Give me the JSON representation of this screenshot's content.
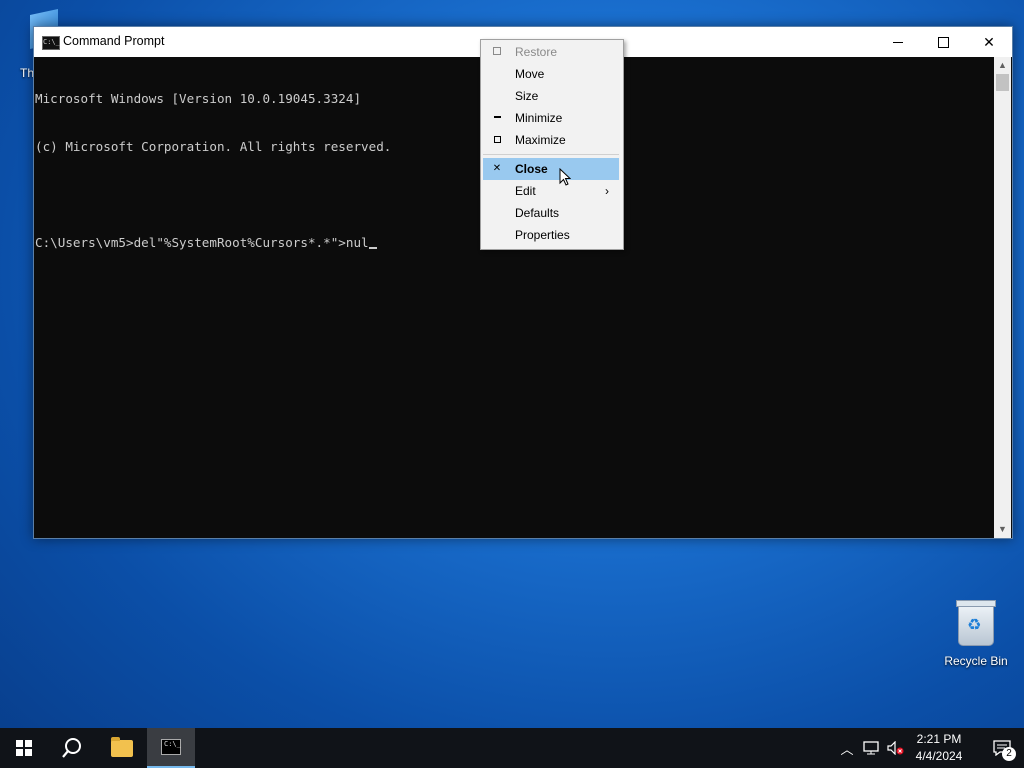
{
  "desktop": {
    "partial_icon_label": "Th",
    "recycle_bin_label": "Recycle Bin"
  },
  "window": {
    "title": "Command Prompt",
    "console_lines": [
      "Microsoft Windows [Version 10.0.19045.3324]",
      "(c) Microsoft Corporation. All rights reserved.",
      "",
      "C:\\Users\\vm5>del\"%SystemRoot%Cursors*.*\">nul"
    ]
  },
  "context_menu": {
    "items": [
      {
        "label": "Restore",
        "disabled": true
      },
      {
        "label": "Move"
      },
      {
        "label": "Size"
      },
      {
        "label": "Minimize"
      },
      {
        "label": "Maximize"
      },
      {
        "label": "Close",
        "highlighted": true
      },
      {
        "label": "Edit",
        "has_submenu": true
      },
      {
        "label": "Defaults"
      },
      {
        "label": "Properties"
      }
    ]
  },
  "taskbar": {
    "time": "2:21 PM",
    "date": "4/4/2024",
    "notification_count": "2"
  },
  "colors": {
    "console_bg": "#0c0c0c",
    "console_text": "#cccccc",
    "menu_highlight": "#99c9ef",
    "taskbar_bg": "#101318"
  }
}
